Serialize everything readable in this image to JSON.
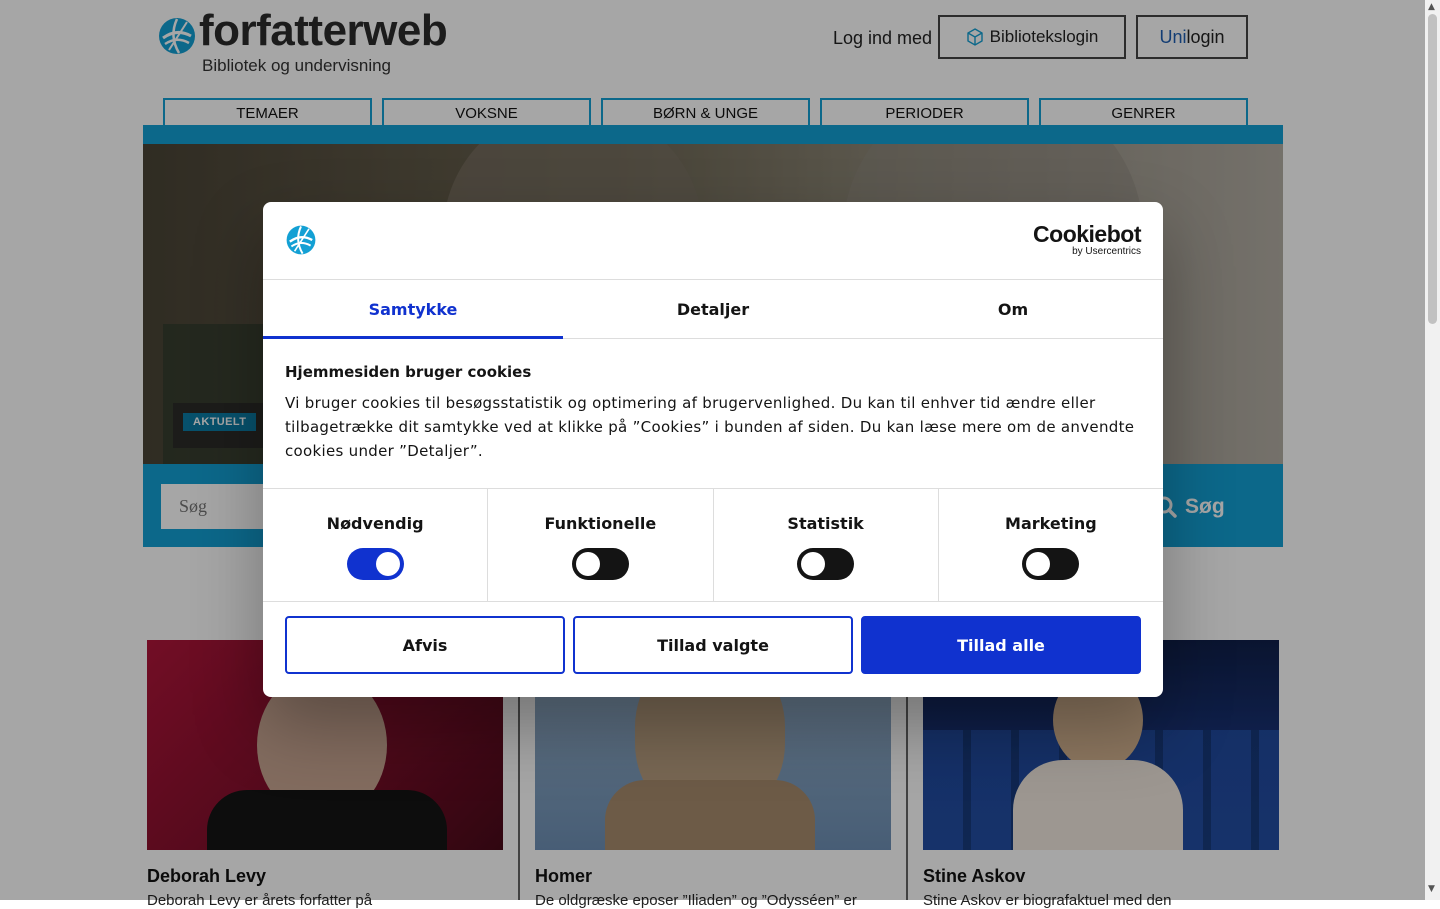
{
  "site": {
    "logo_text": "forfatterweb",
    "logo_subtitle": "Bibliotek og undervisning"
  },
  "login": {
    "label": "Log ind med",
    "bibliotek_button": "Bibliotekslogin",
    "unilogin_prefix": "Uni",
    "unilogin_suffix": "login"
  },
  "nav": {
    "items": [
      "TEMAER",
      "VOKSNE",
      "BØRN & UNGE",
      "PERIODER",
      "GENRER"
    ]
  },
  "hero": {
    "badge": "AKTUELT"
  },
  "search": {
    "placeholder": "Søg",
    "button_label": "Søg"
  },
  "cards": [
    {
      "title": "Deborah Levy",
      "text": "Deborah Levy er årets forfatter på"
    },
    {
      "title": "Homer",
      "text": "De oldgræske eposer ”Iliaden” og ”Odysséen” er"
    },
    {
      "title": "Stine Askov",
      "text": "Stine Askov er biografaktuel med den"
    }
  ],
  "cookie_dialog": {
    "brand_name": "Cookiebot",
    "brand_by": "by Usercentrics",
    "tabs": [
      "Samtykke",
      "Detaljer",
      "Om"
    ],
    "active_tab": "Samtykke",
    "heading": "Hjemmesiden bruger cookies",
    "body": "Vi bruger cookies til besøgsstatistik og optimering af brugervenlighed. Du kan til enhver tid ændre eller tilbagetrække dit samtykke ved at klikke på ”Cookies” i bunden af siden. Du kan læse mere om de anvendte cookies under ”Detaljer”.",
    "categories": [
      {
        "label": "Nødvendig",
        "enabled": true
      },
      {
        "label": "Funktionelle",
        "enabled": false
      },
      {
        "label": "Statistik",
        "enabled": false
      },
      {
        "label": "Marketing",
        "enabled": false
      }
    ],
    "buttons": {
      "reject": "Afvis",
      "allow_selected": "Tillad valgte",
      "allow_all": "Tillad alle"
    }
  },
  "colors": {
    "brand_blue": "#13a0d4",
    "cookiebot_blue": "#1032cf",
    "badge_blue": "#0b7da6"
  }
}
